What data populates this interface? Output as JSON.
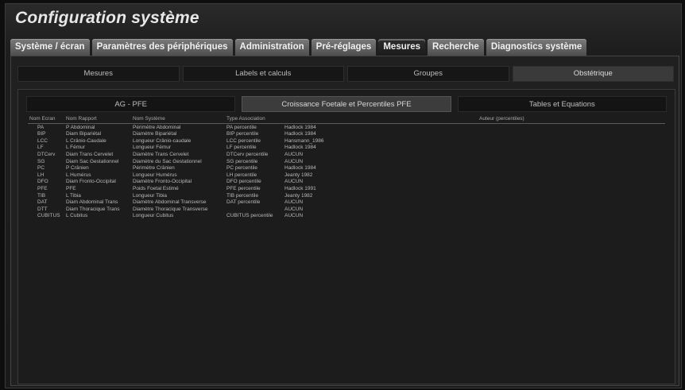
{
  "app": {
    "title": "Configuration système"
  },
  "tabs": [
    {
      "label": "Système / écran"
    },
    {
      "label": "Paramètres des périphériques"
    },
    {
      "label": "Administration"
    },
    {
      "label": "Pré-réglages"
    },
    {
      "label": "Mesures",
      "active": true
    },
    {
      "label": "Recherche"
    },
    {
      "label": "Diagnostics système"
    }
  ],
  "subtabs": [
    {
      "label": "Mesures"
    },
    {
      "label": "Labels et calculs"
    },
    {
      "label": "Groupes"
    },
    {
      "label": "Obstétrique",
      "active": true
    }
  ],
  "subsubtabs": [
    {
      "label": "AG - PFE"
    },
    {
      "label": "Croissance Foetale et Percentiles PFE",
      "active": true
    },
    {
      "label": "Tables et Equations"
    }
  ],
  "table": {
    "headers": [
      "Nom Ecran",
      "Nom Rapport",
      "Nom Système",
      "Type Association",
      "",
      "Auteur (percentiles)"
    ],
    "rows": [
      [
        "PA",
        "P Abdominal",
        "Périmètre Abdominal",
        "PA percentile",
        "Hadlock 1984"
      ],
      [
        "BIP",
        "Diam Bipariétal",
        "Diamètre Bipariétal",
        "BIP percentile",
        "Hadlock 1984"
      ],
      [
        "LCC",
        "L Crânio-Caudale",
        "Longueur Crânio-caudale",
        "LCC percentile",
        "Hansmann_1986"
      ],
      [
        "LF",
        "L Fémur",
        "Longueur Fémur",
        "LF percentile",
        "Hadlock 1984"
      ],
      [
        "DTCerv",
        "Diam Trans Cervelet",
        "Diamètre Trans Cervelet",
        "DTCerv percentile",
        "AUCUN"
      ],
      [
        "SG",
        "Diam Sac Gestationnel",
        "Diamètre du Sac Gestationnel",
        "SG percentile",
        "AUCUN"
      ],
      [
        "PC",
        "P Crânien",
        "Périmètre Crânien",
        "PC percentile",
        "Hadlock 1984"
      ],
      [
        "LH",
        "L Humérus",
        "Longueur Humérus",
        "LH percentile",
        "Jeanty 1982"
      ],
      [
        "DFO",
        "Diam Fronto-Occipital",
        "Diamètre Fronto-Occipital",
        "DFO percentile",
        "AUCUN"
      ],
      [
        "PFE",
        "PFE",
        "Poids Foetal Estimé",
        "PFE percentile",
        "Hadlock 1991"
      ],
      [
        "TIB",
        "L Tibia",
        "Longueur Tibia",
        "TIB percentile",
        "Jeanty 1982"
      ],
      [
        "DAT",
        "Diam Abdominal Trans",
        "Diamètre Abdominal Transverse",
        "DAT percentile",
        "AUCUN"
      ],
      [
        "DTT",
        "Diam Thoracique Trans",
        "Diamètre Thoracique Transverse",
        "",
        "AUCUN"
      ],
      [
        "CUBITUS",
        "L Cubitus",
        "Longueur Cubitus",
        "CUBITUS percentile",
        "AUCUN"
      ]
    ]
  }
}
